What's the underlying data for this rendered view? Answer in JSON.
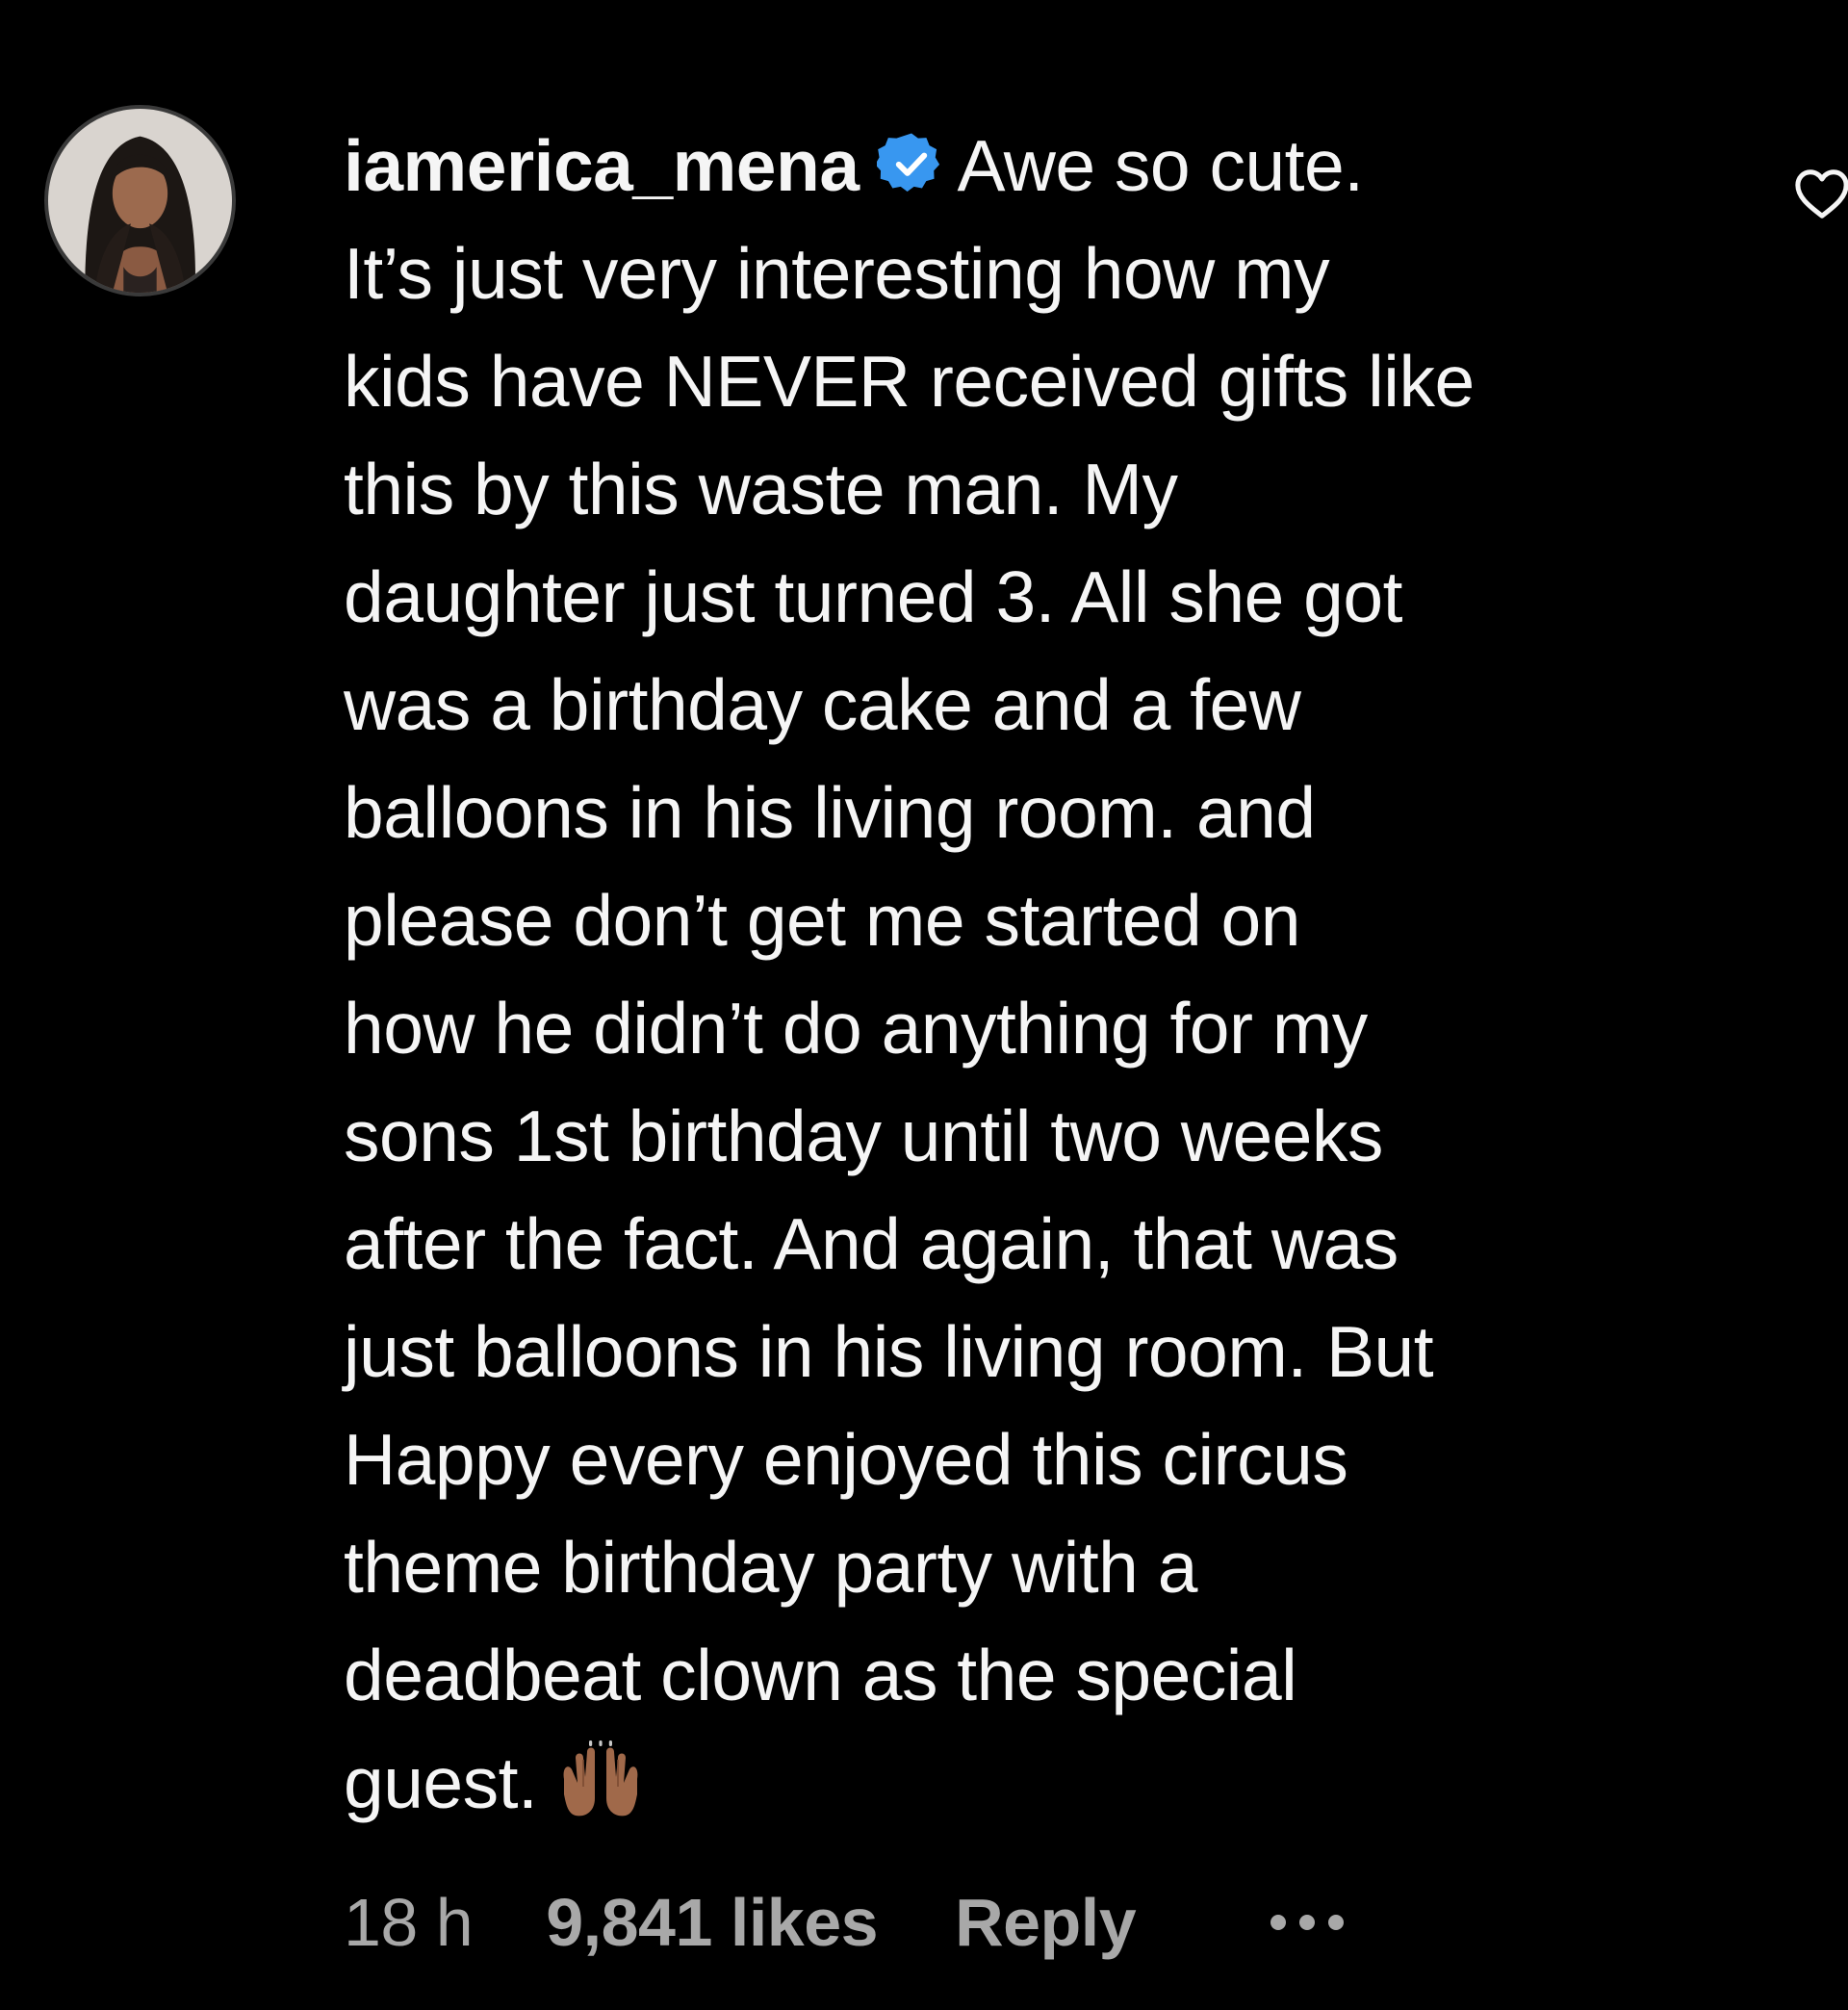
{
  "comment": {
    "username": "iamerica_mena",
    "verified": true,
    "first_line_text": "Awe so cute.",
    "lines": [
      "It’s just very interesting how my",
      "kids have NEVER received gifts like",
      "this by this waste man. My",
      "daughter just turned 3. All she got",
      "was a birthday cake and a few",
      "balloons in his living room. and",
      "please don’t get me started on",
      "how he didn’t do anything for my",
      "sons 1st birthday until two weeks",
      "after the fact. And again, that was",
      "just balloons in his living room. But",
      "Happy every enjoyed this circus",
      "theme birthday party with a",
      "deadbeat clown as the special"
    ],
    "last_line_text": "guest.",
    "last_line_emoji": "raising-hands-emoji",
    "meta": {
      "time": "18 h",
      "likes": "9,841 likes",
      "reply_label": "Reply"
    }
  },
  "icons": {
    "verified_badge": "verified-badge-icon",
    "like": "heart-outline-icon",
    "more": "more-options-icon"
  },
  "colors": {
    "background": "#000000",
    "text": "#f5f5f5",
    "secondary_text": "#a8a8a8",
    "verified_blue": "#3897f0"
  }
}
